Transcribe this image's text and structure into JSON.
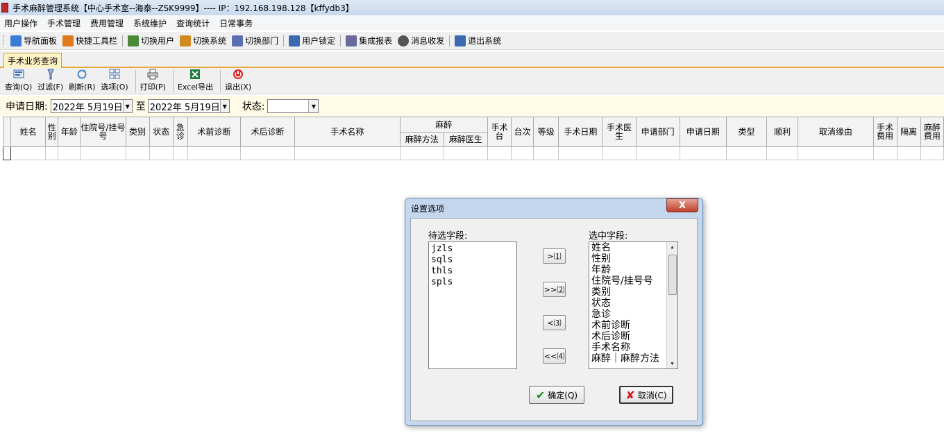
{
  "window": {
    "title": "手术麻醉管理系统【中心手术室--海泰--ZSK9999】---- IP：192.168.198.128【kffydb3】"
  },
  "menu": [
    "用户操作",
    "手术管理",
    "费用管理",
    "系统维护",
    "查询统计",
    "日常事务"
  ],
  "toolbar": [
    {
      "label": "导航面板",
      "icon": "dashboard-icon",
      "color": "#3a7bd5"
    },
    {
      "label": "快捷工具栏",
      "icon": "shortcut-icon",
      "color": "#e07a1e"
    },
    {
      "label": "切换用户",
      "icon": "switch-user-icon",
      "color": "#4a8a3a"
    },
    {
      "label": "切换系统",
      "icon": "switch-system-icon",
      "color": "#d08a20"
    },
    {
      "label": "切换部门",
      "icon": "switch-department-icon",
      "color": "#5a6fb0"
    },
    {
      "label": "用户锁定",
      "icon": "user-lock-icon",
      "color": "#3a6ab0"
    },
    {
      "label": "集成报表",
      "icon": "report-icon",
      "color": "#6a6a9a"
    },
    {
      "label": "消息收发",
      "icon": "message-icon",
      "color": "#555555"
    },
    {
      "label": "退出系统",
      "icon": "exit-icon",
      "color": "#3a6ab0"
    }
  ],
  "tab": {
    "label": "手术业务查询"
  },
  "actions": [
    {
      "label": "查询(Q)",
      "icon": "query-icon",
      "color": "#3a6ab0"
    },
    {
      "label": "过滤(F)",
      "icon": "filter-icon",
      "color": "#5a7fb0"
    },
    {
      "label": "刷新(R)",
      "icon": "refresh-icon",
      "color": "#4a8ad0"
    },
    {
      "label": "选项(O)",
      "icon": "options-icon",
      "color": "#5a7fb0"
    },
    {
      "label": "打印(P)",
      "icon": "print-icon",
      "color": "#666666"
    },
    {
      "label": "Excel导出",
      "icon": "excel-icon",
      "color": "#1e7a3a"
    },
    {
      "label": "退出(X)",
      "icon": "power-icon",
      "color": "#d02020"
    }
  ],
  "filter": {
    "apply_date_label": "申请日期:",
    "date_from": "2022年  5月19日",
    "to_label": "至",
    "date_to": "2022年  5月19日",
    "status_label": "状态:",
    "status_value": ""
  },
  "grid": {
    "columns_row1": [
      "姓名",
      "性别",
      "年龄",
      "住院号/挂号号",
      "类别",
      "状态",
      "急诊",
      "术前诊断",
      "术后诊断",
      "手术名称",
      "麻醉",
      "手术台",
      "台次",
      "等级",
      "手术日期",
      "手术医生",
      "申请部门",
      "申请日期",
      "类型",
      "顺利",
      "取消缘由",
      "手术费用",
      "隔离",
      "麻醉费用"
    ],
    "columns_row2": [
      "麻醉方法",
      "麻醉医生"
    ]
  },
  "dialog": {
    "title": "设置选项",
    "close_label": "X",
    "available_label": "待选字段:",
    "selected_label": "选中字段:",
    "available_items": [
      "jzls",
      "sqls",
      "thls",
      "spls"
    ],
    "selected_items": [
      "姓名",
      "性别",
      "年龄",
      "住院号/挂号号",
      "类别",
      "状态",
      "急诊",
      "术前诊断",
      "术后诊断",
      "手术名称",
      "麻醉｜麻醉方法"
    ],
    "btn_add": ">⑴",
    "btn_add_all": ">>⑵",
    "btn_remove": "<⑶",
    "btn_remove_all": "<<⑷",
    "ok_label": "确定(Q)",
    "cancel_label": "取消(C)"
  }
}
